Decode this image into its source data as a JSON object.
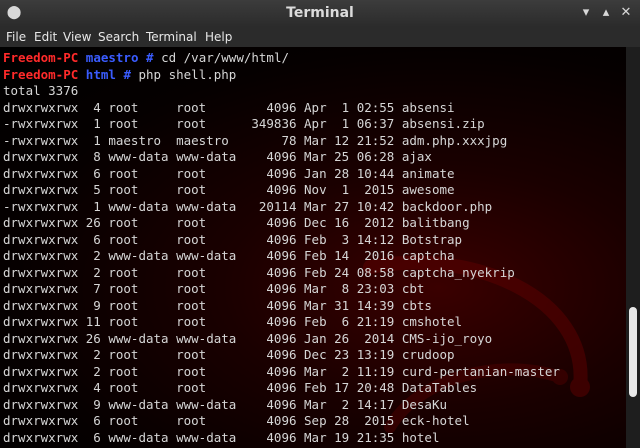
{
  "window": {
    "title": "Terminal"
  },
  "menu": [
    "File",
    "Edit",
    "View",
    "Search",
    "Terminal",
    "Help"
  ],
  "prompts": [
    {
      "host": "Freedom-PC",
      "dir": "maestro",
      "symbol": "#",
      "command": "cd /var/www/html/"
    },
    {
      "host": "Freedom-PC",
      "dir": "html",
      "symbol": "#",
      "command": "php shell.php"
    }
  ],
  "output": [
    "total 3376",
    "drwxrwxrwx  4 root     root        4096 Apr  1 02:55 absensi",
    "-rwxrwxrwx  1 root     root      349836 Apr  1 06:37 absensi.zip",
    "-rwxrwxrwx  1 maestro  maestro       78 Mar 12 21:52 adm.php.xxxjpg",
    "drwxrwxrwx  8 www-data www-data    4096 Mar 25 06:28 ajax",
    "drwxrwxrwx  6 root     root        4096 Jan 28 10:44 animate",
    "drwxrwxrwx  5 root     root        4096 Nov  1  2015 awesome",
    "-rwxrwxrwx  1 www-data www-data   20114 Mar 27 10:42 backdoor.php",
    "drwxrwxrwx 26 root     root        4096 Dec 16  2012 balitbang",
    "drwxrwxrwx  6 root     root        4096 Feb  3 14:12 Botstrap",
    "drwxrwxrwx  2 www-data www-data    4096 Feb 14  2016 captcha",
    "drwxrwxrwx  2 root     root        4096 Feb 24 08:58 captcha_nyekrip",
    "drwxrwxrwx  7 root     root        4096 Mar  8 23:03 cbt",
    "drwxrwxrwx  9 root     root        4096 Mar 31 14:39 cbts",
    "drwxrwxrwx 11 root     root        4096 Feb  6 21:19 cmshotel",
    "drwxrwxrwx 26 www-data www-data    4096 Jan 26  2014 CMS-ijo_royo",
    "drwxrwxrwx  2 root     root        4096 Dec 23 13:19 crudoop",
    "drwxrwxrwx  2 root     root        4096 Mar  2 11:19 curd-pertanian-master",
    "drwxrwxrwx  4 root     root        4096 Feb 17 20:48 DataTables",
    "drwxrwxrwx  9 www-data www-data    4096 Mar  2 14:17 DesaKu",
    "drwxrwxrwx  6 root     root        4096 Sep 28  2015 eck-hotel",
    "drwxrwxrwx  6 www-data www-data    4096 Mar 19 21:35 hotel"
  ]
}
